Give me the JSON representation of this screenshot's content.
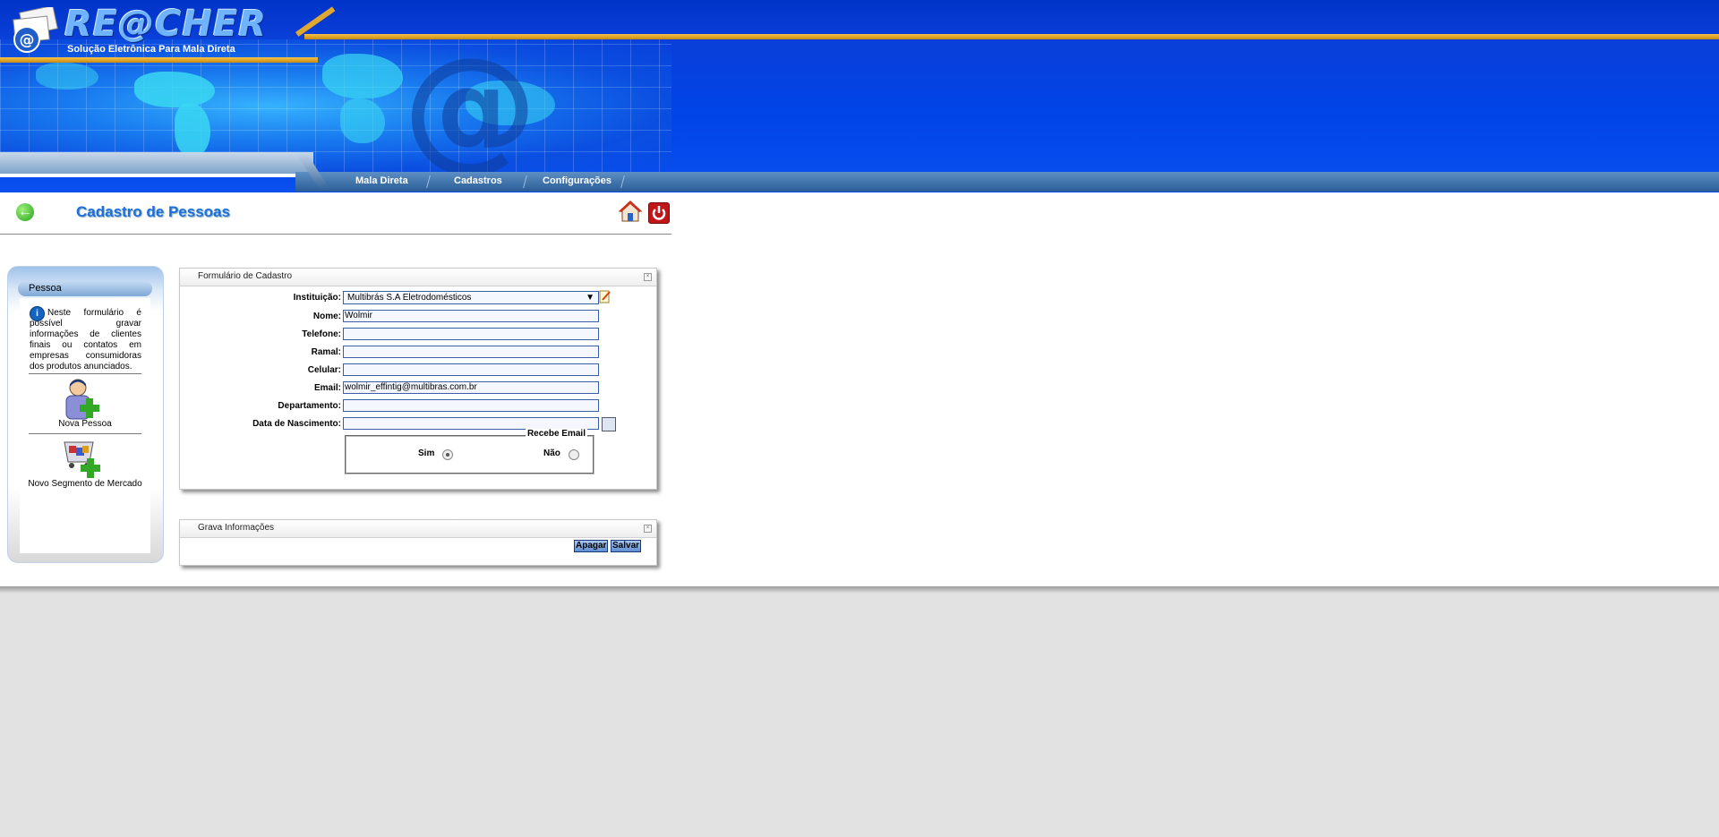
{
  "header": {
    "logo_title": "RE@CHER",
    "logo_subtitle": "Solução Eletrônica Para Mala Direta",
    "background_color": "#0044e8",
    "accent_gold": "#f7c34a"
  },
  "menu": {
    "items": [
      {
        "label": "Mala Direta"
      },
      {
        "label": "Cadastros"
      },
      {
        "label": "Configurações"
      }
    ]
  },
  "page": {
    "title": "Cadastro de Pessoas",
    "title_color": "#1b6fe0",
    "icons": [
      "back-arrow-icon",
      "home-icon",
      "power-icon"
    ]
  },
  "sidebar": {
    "header": "Pessoa",
    "info_text": "Neste formulário é possível gravar informações de clientes finais ou contatos em empresas consumidoras dos produtos anunciados.",
    "actions": [
      {
        "label": "Nova Pessoa",
        "icon": "add-person-icon"
      },
      {
        "label": "Novo Segmento de Mercado",
        "icon": "add-segment-icon"
      }
    ]
  },
  "form": {
    "panel_title": "Formulário de Cadastro",
    "fields": {
      "instituicao": {
        "label": "Instituição:",
        "value": "Multibrás S.A Eletrodomésticos"
      },
      "nome": {
        "label": "Nome:",
        "value": "Wolmir"
      },
      "telefone": {
        "label": "Telefone:",
        "value": ""
      },
      "ramal": {
        "label": "Ramal:",
        "value": ""
      },
      "celular": {
        "label": "Celular:",
        "value": ""
      },
      "email": {
        "label": "Email:",
        "value": "wolmir_effintig@multibras.com.br"
      },
      "departamento": {
        "label": "Departamento:",
        "value": ""
      },
      "nascimento": {
        "label": "Data de Nascimento:",
        "value": ""
      }
    },
    "recebe_email": {
      "legend": "Recebe Email",
      "options": [
        {
          "label": "Sim",
          "checked": true
        },
        {
          "label": "Não",
          "checked": false
        }
      ]
    }
  },
  "save_panel": {
    "title": "Grava Informações",
    "buttons": {
      "delete": "Apagar",
      "save": "Salvar"
    }
  }
}
